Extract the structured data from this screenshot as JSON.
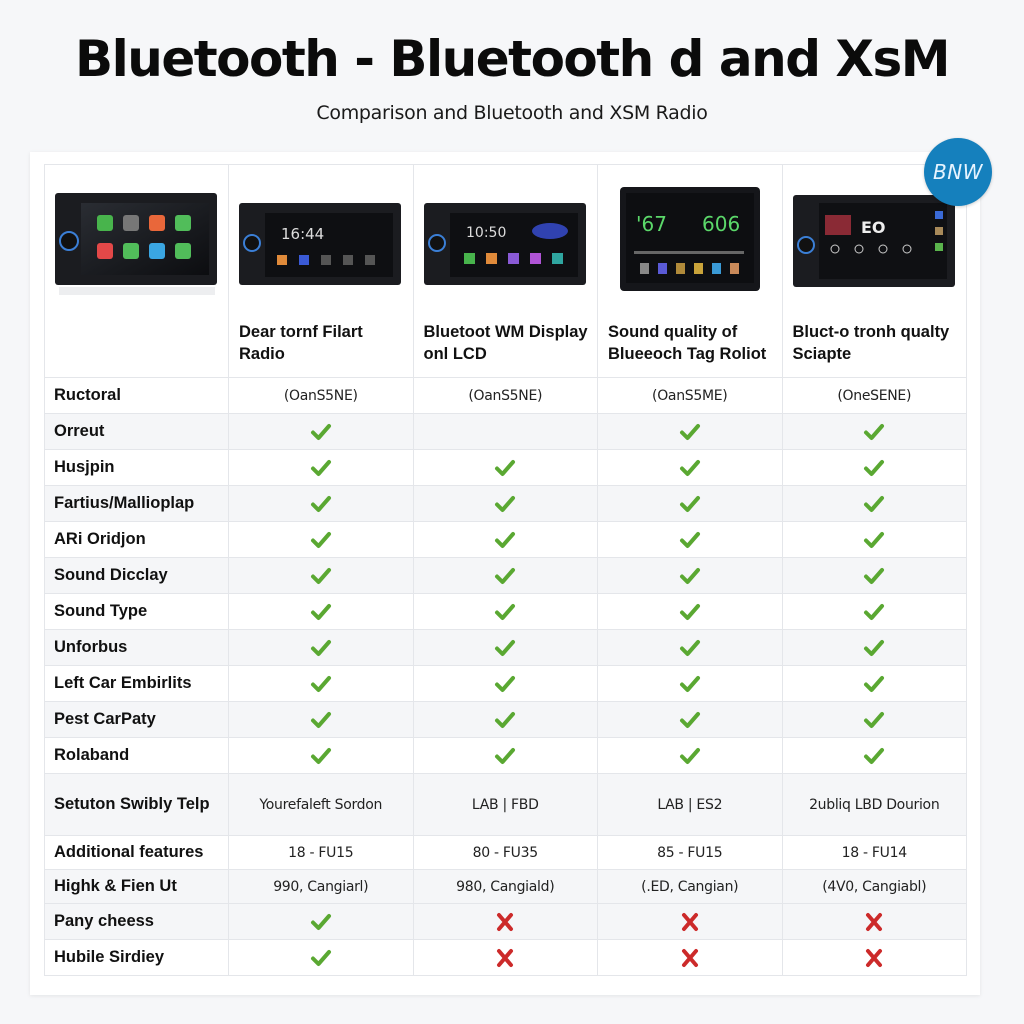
{
  "header": {
    "title": "Bluetooth - Bluetooth d and XsM",
    "subtitle": "Comparison and Bluetooth and XSM Radio"
  },
  "badge": {
    "label": "BNW",
    "color": "#1580bd"
  },
  "colors": {
    "check": "#5aa832",
    "cross": "#cc2a2a",
    "border": "#e4e6ea",
    "row_alt": "#f5f6f8"
  },
  "products": [
    {
      "name": "",
      "screen": "app-grid",
      "image_icon": "car-stereo-image"
    },
    {
      "name": "Dear tornf Filart Radio",
      "screen_time": "16:44",
      "image_icon": "car-stereo-image"
    },
    {
      "name": "Bluetoot WM Display onl LCD",
      "screen_time": "10:50",
      "image_icon": "car-stereo-image"
    },
    {
      "name": "Sound quality of Blueeoch Tag Roliot",
      "screen_time": "'67   606",
      "image_icon": "car-stereo-image"
    },
    {
      "name": "Bluct-o tronh qualty Sciapte",
      "screen_time": "",
      "image_icon": "car-stereo-image"
    }
  ],
  "rows": [
    {
      "feature": "Ructoral",
      "type": "text",
      "values": [
        "(OanS5NE)",
        "(OanS5NE)",
        "(OanS5ME)",
        "(OneSENE)"
      ]
    },
    {
      "feature": "Orreut",
      "type": "mark",
      "values": [
        "check",
        "",
        "check",
        "check"
      ]
    },
    {
      "feature": "Husjpin",
      "type": "mark",
      "values": [
        "check",
        "check",
        "check",
        "check"
      ]
    },
    {
      "feature": "Fartius/Mallioplap",
      "type": "mark",
      "values": [
        "check",
        "check",
        "check",
        "check"
      ]
    },
    {
      "feature": "ARi Oridjon",
      "type": "mark",
      "values": [
        "check",
        "check",
        "check",
        "check"
      ]
    },
    {
      "feature": "Sound Dicclay",
      "type": "mark",
      "values": [
        "check",
        "check",
        "check",
        "check"
      ]
    },
    {
      "feature": "Sound Type",
      "type": "mark",
      "values": [
        "check",
        "check",
        "check",
        "check"
      ]
    },
    {
      "feature": "Unforbus",
      "type": "mark",
      "values": [
        "check",
        "check",
        "check",
        "check"
      ]
    },
    {
      "feature": "Left Car Embirlits",
      "type": "mark",
      "values": [
        "check",
        "check",
        "check",
        "check"
      ]
    },
    {
      "feature": "Pest CarPaty",
      "type": "mark",
      "values": [
        "check",
        "check",
        "check",
        "check"
      ]
    },
    {
      "feature": "Rolaband",
      "type": "mark",
      "values": [
        "check",
        "check",
        "check",
        "check"
      ]
    },
    {
      "feature": "Setuton Swibly Telp",
      "type": "text",
      "values": [
        "Yourefaleft Sordon",
        "LAB | FBD",
        "LAB | ES2",
        "2ubliq LBD Dourion"
      ]
    },
    {
      "feature": "Additional features",
      "type": "text",
      "values": [
        "18 - FU15",
        "80 - FU35",
        "85 - FU15",
        "18 - FU14"
      ]
    },
    {
      "feature": "Highk & Fien Ut",
      "type": "text",
      "values": [
        "990, Cangiarl)",
        "980, Cangiald)",
        "(.ED, Cangian)",
        "(4V0, Cangiabl)"
      ]
    },
    {
      "feature": "Pany cheess",
      "type": "mark",
      "values": [
        "check",
        "cross",
        "cross",
        "cross"
      ]
    },
    {
      "feature": "Hubile Sirdiey",
      "type": "mark",
      "values": [
        "check",
        "cross",
        "cross",
        "cross"
      ]
    }
  ]
}
